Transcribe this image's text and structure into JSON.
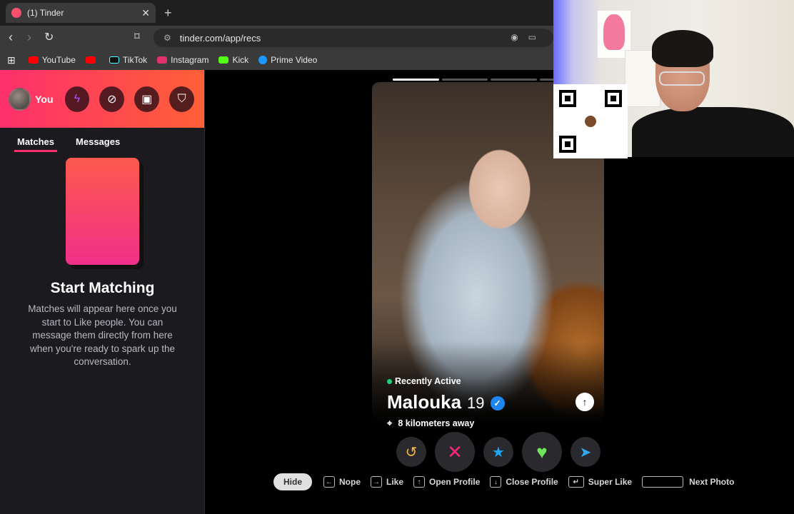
{
  "browser": {
    "tab_title": "(1) Tinder",
    "tab_close": "✕",
    "new_tab": "+",
    "url": "tinder.com/app/recs",
    "bookmarks": [
      {
        "label": "YouTube",
        "color": "#ff0000"
      },
      {
        "label": "",
        "color": "#ff0000"
      },
      {
        "label": "TikTok",
        "color": "#111111"
      },
      {
        "label": "Instagram",
        "color": "#e1306c"
      },
      {
        "label": "Kick",
        "color": "#53fc18"
      },
      {
        "label": "Prime Video",
        "color": "#1a98ff"
      }
    ]
  },
  "sidebar": {
    "profile_label": "You",
    "nav_icons": [
      "boost-icon",
      "explore-icon",
      "briefcase-icon",
      "shield-icon"
    ],
    "tabs": [
      {
        "label": "Matches",
        "active": true
      },
      {
        "label": "Messages",
        "active": false
      }
    ],
    "empty_title": "Start Matching",
    "empty_body": "Matches will appear here once you start to Like people. You can message them directly from here when you're ready to spark up the conversation."
  },
  "card": {
    "status": "Recently Active",
    "name": "Malouka",
    "age": "19",
    "distance": "8 kilometers away",
    "photo_count": 4
  },
  "actions": [
    {
      "name": "rewind",
      "icon": "↺",
      "color": "#f5b748"
    },
    {
      "name": "nope",
      "icon": "✕",
      "color": "#fd267d"
    },
    {
      "name": "super-like",
      "icon": "★",
      "color": "#1fa6f4"
    },
    {
      "name": "like",
      "icon": "♥",
      "color": "#6fe35b"
    },
    {
      "name": "boost",
      "icon": "➤",
      "color": "#32a6ef"
    }
  ],
  "shortcuts": {
    "hide": "Hide",
    "items": [
      {
        "key": "←",
        "label": "Nope"
      },
      {
        "key": "→",
        "label": "Like"
      },
      {
        "key": "↑",
        "label": "Open Profile"
      },
      {
        "key": "↓",
        "label": "Close Profile"
      },
      {
        "key": "↵",
        "label": "Super Like"
      },
      {
        "key": "",
        "label": "Next Photo"
      }
    ]
  },
  "colors": {
    "brand_start": "#fd2f6c",
    "brand_end": "#ff6036",
    "verified": "#1d86f3",
    "active_dot": "#21d07a"
  }
}
